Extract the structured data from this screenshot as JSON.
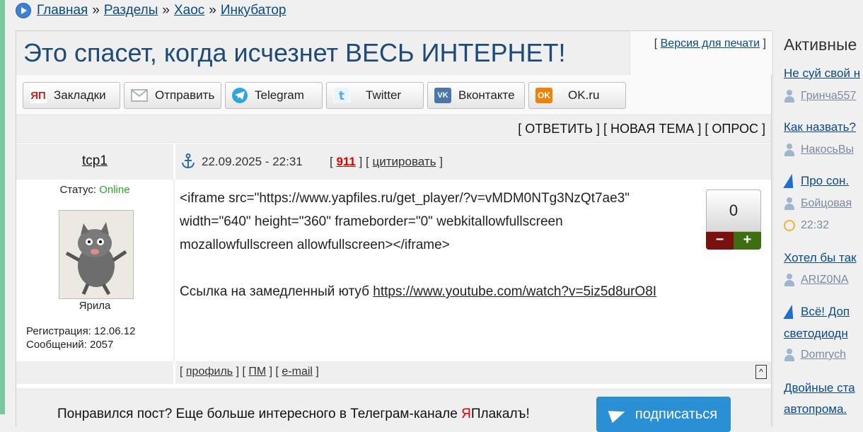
{
  "breadcrumb": {
    "items": [
      "Главная",
      "Разделы",
      "Хаос",
      "Инкубатор"
    ],
    "separator": "»"
  },
  "topic": {
    "title": "Это спасет, когда исчезнет ВЕСЬ ИНТЕРНЕТ!",
    "print_link": "Версия для печати"
  },
  "share": {
    "buttons": [
      {
        "label": "Закладки",
        "icon": "yap-bookmark-icon",
        "color": "#cc1f1f"
      },
      {
        "label": "Отправить",
        "icon": "envelope-icon",
        "color": "#9aa3ad"
      },
      {
        "label": "Telegram",
        "icon": "telegram-icon",
        "color": "#2fa5e0"
      },
      {
        "label": "Twitter",
        "icon": "twitter-icon",
        "color": "#55acee"
      },
      {
        "label": "Вконтакте",
        "icon": "vk-icon",
        "color": "#4a76a8"
      },
      {
        "label": "OK.ru",
        "icon": "ok-icon",
        "color": "#ee8208"
      }
    ]
  },
  "actions": {
    "reply": "ОТВЕТИТЬ",
    "new_topic": "НОВАЯ ТЕМА",
    "poll": "ОПРОС"
  },
  "post": {
    "author": "tcp1",
    "date": "22.09.2025 - 22:31",
    "number": "911",
    "quote": "цитировать",
    "status_label": "Статус:",
    "status_value": "Online",
    "avatar_caption": "Ярила",
    "registration": "Регистрация: 12.06.12",
    "messages": "Сообщений: 2057",
    "body_lines": [
      "<iframe src=\"https://www.yapfiles.ru/get_player/?v=vMDM0NTg3NzQt7ae3\"",
      "width=\"640\" height=\"360\" frameborder=\"0\" webkitallowfullscreen",
      "mozallowfullscreen allowfullscreen></iframe>"
    ],
    "link_prefix": "Ссылка на замедленный ютуб ",
    "link_url": "https://www.youtube.com/watch?v=5iz5d8urO8I",
    "rating": "0",
    "rating_minus": "−",
    "rating_plus": "+",
    "footer": {
      "profile": "профиль",
      "pm": "ПМ",
      "email": "e-mail",
      "to_top": "^"
    }
  },
  "promo": {
    "text_before": "Понравился пост? Еще больше интересного в Телеграм-канале ",
    "brand_red": "Я",
    "brand_rest": "Плакалъ",
    "text_after": "!",
    "subscribe": "подписаться"
  },
  "sidebar": {
    "title": "Активные",
    "items": [
      {
        "title": "Не суй свой н",
        "user": "Гринча557"
      },
      {
        "title": "Как назвать?",
        "user": "НакосьВы"
      },
      {
        "title": "Про сон.",
        "user": "Бойцовая",
        "time": "22:32",
        "hot": true
      },
      {
        "title": "Хотел бы так",
        "user": "ARIZ0NA"
      },
      {
        "title": "Всё! Доп",
        "title2": "светодиодн",
        "user": "Domrych",
        "hot": true
      },
      {
        "title": "Двойные ста",
        "title2": "автопрома."
      }
    ]
  }
}
